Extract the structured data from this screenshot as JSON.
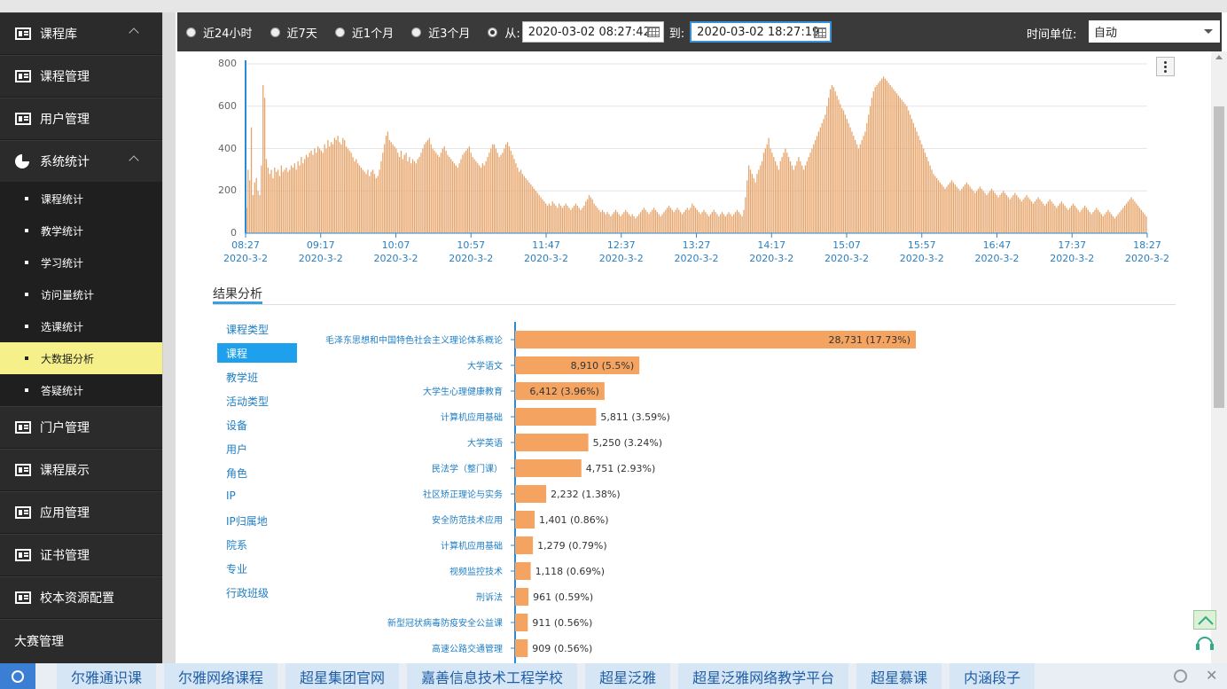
{
  "sidebar": {
    "items": [
      {
        "label": "课程库",
        "icon": "grid-icon",
        "expanded": true
      },
      {
        "label": "课程管理",
        "icon": "grid-icon"
      },
      {
        "label": "用户管理",
        "icon": "grid-icon"
      },
      {
        "label": "系统统计",
        "icon": "pie-icon",
        "expanded": true
      }
    ],
    "subitems": [
      "课程统计",
      "教学统计",
      "学习统计",
      "访问量统计",
      "选课统计",
      "大数据分析",
      "答疑统计"
    ],
    "active_subitem": "大数据分析",
    "lower_items": [
      "门户管理",
      "课程展示",
      "应用管理",
      "证书管理",
      "校本资源配置"
    ],
    "last_item": "大赛管理"
  },
  "filter": {
    "ranges": [
      "近24小时",
      "近7天",
      "近1个月",
      "近3个月"
    ],
    "selected": "custom",
    "from_label": "从:",
    "from_value": "2020-03-02 08:27:42",
    "to_label": "到:",
    "to_value": "2020-03-02 18:27:19",
    "unit_label": "时间单位:",
    "unit_value": "自动"
  },
  "chart_data": {
    "type": "bar",
    "title": "",
    "ylim": [
      0,
      800
    ],
    "y_ticks": [
      0,
      200,
      400,
      600,
      800
    ],
    "x_ticks": [
      "08:27",
      "09:17",
      "10:07",
      "10:57",
      "11:47",
      "12:37",
      "13:27",
      "14:17",
      "15:07",
      "15:57",
      "16:47",
      "17:37",
      "18:27"
    ],
    "x_date": "2020-3-2",
    "series": [
      {
        "values": [
          120,
          300,
          250,
          500,
          180,
          240,
          260,
          200,
          180,
          320,
          700,
          640,
          350,
          310,
          280,
          300,
          260,
          310,
          290,
          300,
          270,
          320,
          290,
          300,
          310,
          290,
          300,
          320,
          310,
          330,
          300,
          340,
          320,
          360,
          330,
          350,
          370,
          360,
          380,
          390,
          370,
          400,
          380,
          410,
          400,
          390,
          380,
          420,
          400,
          440,
          410,
          430,
          420,
          450,
          440,
          460,
          430,
          420,
          450,
          440,
          410,
          400,
          390,
          380,
          360,
          340,
          350,
          330,
          320,
          310,
          300,
          290,
          280,
          300,
          270,
          290,
          300,
          280,
          260,
          270,
          300,
          340,
          380,
          420,
          460,
          480,
          440,
          430,
          420,
          410,
          400,
          380,
          360,
          390,
          350,
          370,
          380,
          340,
          360,
          330,
          350,
          340,
          330,
          350,
          360,
          380,
          400,
          420,
          430,
          440,
          450,
          420,
          400,
          390,
          380,
          370,
          360,
          380,
          400,
          410,
          390,
          370,
          360,
          350,
          340,
          330,
          320,
          310,
          330,
          350,
          370,
          380,
          390,
          400,
          410,
          380,
          360,
          350,
          340,
          330,
          320,
          310,
          330,
          320,
          340,
          360,
          380,
          400,
          420,
          420,
          400,
          380,
          360,
          370,
          380,
          400,
          420,
          430,
          410,
          390,
          370,
          350,
          330,
          310,
          290,
          300,
          280,
          270,
          260,
          250,
          240,
          230,
          220,
          210,
          200,
          190,
          180,
          170,
          160,
          150,
          140,
          130,
          140,
          130,
          150,
          140,
          130,
          120,
          140,
          130,
          120,
          130,
          140,
          130,
          120,
          110,
          120,
          130,
          140,
          130,
          120,
          110,
          120,
          130,
          150,
          160,
          180,
          170,
          160,
          140,
          130,
          120,
          110,
          100,
          110,
          100,
          90,
          100,
          90,
          80,
          90,
          100,
          110,
          100,
          90,
          80,
          90,
          100,
          110,
          100,
          90,
          80,
          90,
          80,
          70,
          80,
          90,
          100,
          110,
          120,
          110,
          100,
          90,
          100,
          110,
          120,
          110,
          100,
          90,
          80,
          90,
          100,
          110,
          120,
          130,
          120,
          110,
          100,
          110,
          120,
          110,
          100,
          90,
          100,
          110,
          120,
          110,
          120,
          140,
          130,
          120,
          110,
          100,
          90,
          100,
          110,
          100,
          90,
          80,
          90,
          100,
          110,
          100,
          90,
          80,
          90,
          100,
          90,
          80,
          90,
          100,
          90,
          80,
          90,
          100,
          110,
          100,
          90,
          80,
          110,
          170,
          250,
          320,
          300,
          280,
          260,
          240,
          280,
          300,
          320,
          340,
          380,
          400,
          420,
          450,
          400,
          380,
          360,
          340,
          320,
          300,
          340,
          360,
          380,
          400,
          380,
          360,
          340,
          320,
          300,
          320,
          340,
          360,
          340,
          320,
          300,
          320,
          340,
          360,
          380,
          400,
          420,
          440,
          460,
          480,
          500,
          520,
          540,
          560,
          600,
          640,
          680,
          700,
          690,
          670,
          650,
          630,
          610,
          590,
          580,
          560,
          540,
          520,
          500,
          480,
          460,
          440,
          420,
          400,
          420,
          440,
          460,
          480,
          520,
          560,
          600,
          640,
          670,
          690,
          700,
          710,
          720,
          730,
          740,
          730,
          720,
          710,
          700,
          690,
          680,
          670,
          660,
          650,
          640,
          630,
          620,
          610,
          600,
          580,
          560,
          540,
          520,
          500,
          480,
          460,
          440,
          420,
          400,
          380,
          360,
          340,
          320,
          300,
          280,
          270,
          260,
          250,
          240,
          230,
          220,
          210,
          220,
          230,
          240,
          250,
          240,
          230,
          220,
          210,
          200,
          210,
          220,
          230,
          240,
          230,
          220,
          210,
          200,
          190,
          200,
          210,
          220,
          210,
          200,
          190,
          180,
          190,
          200,
          210,
          200,
          190,
          180,
          170,
          180,
          190,
          200,
          190,
          180,
          170,
          160,
          170,
          180,
          190,
          180,
          170,
          160,
          150,
          160,
          170,
          180,
          170,
          160,
          150,
          140,
          150,
          160,
          170,
          160,
          150,
          140,
          130,
          140,
          150,
          160,
          150,
          140,
          130,
          120,
          130,
          140,
          150,
          140,
          130,
          120,
          110,
          120,
          130,
          140,
          130,
          120,
          110,
          100,
          110,
          120,
          130,
          120,
          110,
          100,
          90,
          100,
          110,
          120,
          110,
          100,
          90,
          80,
          90,
          100,
          110,
          100,
          90,
          80,
          70,
          80,
          90,
          100,
          110,
          120,
          130,
          140,
          150,
          160,
          170,
          160,
          150,
          140,
          130,
          120,
          110,
          100,
          90,
          80
        ]
      }
    ]
  },
  "analysis": {
    "title": "结果分析",
    "categories": [
      "课程类型",
      "课程",
      "教学班",
      "活动类型",
      "设备",
      "用户",
      "角色",
      "IP",
      "IP归属地",
      "院系",
      "专业",
      "行政班级"
    ],
    "active_category": "课程",
    "bars": [
      {
        "name": "毛泽东思想和中国特色社会主义理论体系概论",
        "value": 28731,
        "label": "28,731 (17.73%)"
      },
      {
        "name": "大学语文",
        "value": 8910,
        "label": "8,910 (5.5%)"
      },
      {
        "name": "大学生心理健康教育",
        "value": 6412,
        "label": "6,412 (3.96%)"
      },
      {
        "name": "计算机应用基础",
        "value": 5811,
        "label": "5,811 (3.59%)"
      },
      {
        "name": "大学英语",
        "value": 5250,
        "label": "5,250 (3.24%)"
      },
      {
        "name": "民法学（整门课）",
        "value": 4751,
        "label": "4,751 (2.93%)"
      },
      {
        "name": "社区矫正理论与实务",
        "value": 2232,
        "label": "2,232 (1.38%)"
      },
      {
        "name": "安全防范技术应用",
        "value": 1401,
        "label": "1,401 (0.86%)"
      },
      {
        "name": "计算机应用基础",
        "value": 1279,
        "label": "1,279 (0.79%)"
      },
      {
        "name": "视频监控技术",
        "value": 1118,
        "label": "1,118 (0.69%)"
      },
      {
        "name": "刑诉法",
        "value": 961,
        "label": "961 (0.59%)"
      },
      {
        "name": "新型冠状病毒防疫安全公益课",
        "value": 911,
        "label": "911 (0.56%)"
      },
      {
        "name": "高速公路交通管理",
        "value": 909,
        "label": "909 (0.56%)"
      }
    ]
  },
  "taskbar": {
    "links": [
      "尔雅通识课",
      "尔雅网络课程",
      "超星集团官网",
      "嘉善信息技术工程学校",
      "超星泛雅",
      "超星泛雅网络教学平台",
      "超星慕课",
      "内涵段子"
    ]
  },
  "colors": {
    "bar": "#e7a46a",
    "hbar": "#f4a460",
    "axis": "#2a8ad4",
    "sidebar_bg": "#2b2b2b",
    "active_sub": "#f5f08a"
  }
}
